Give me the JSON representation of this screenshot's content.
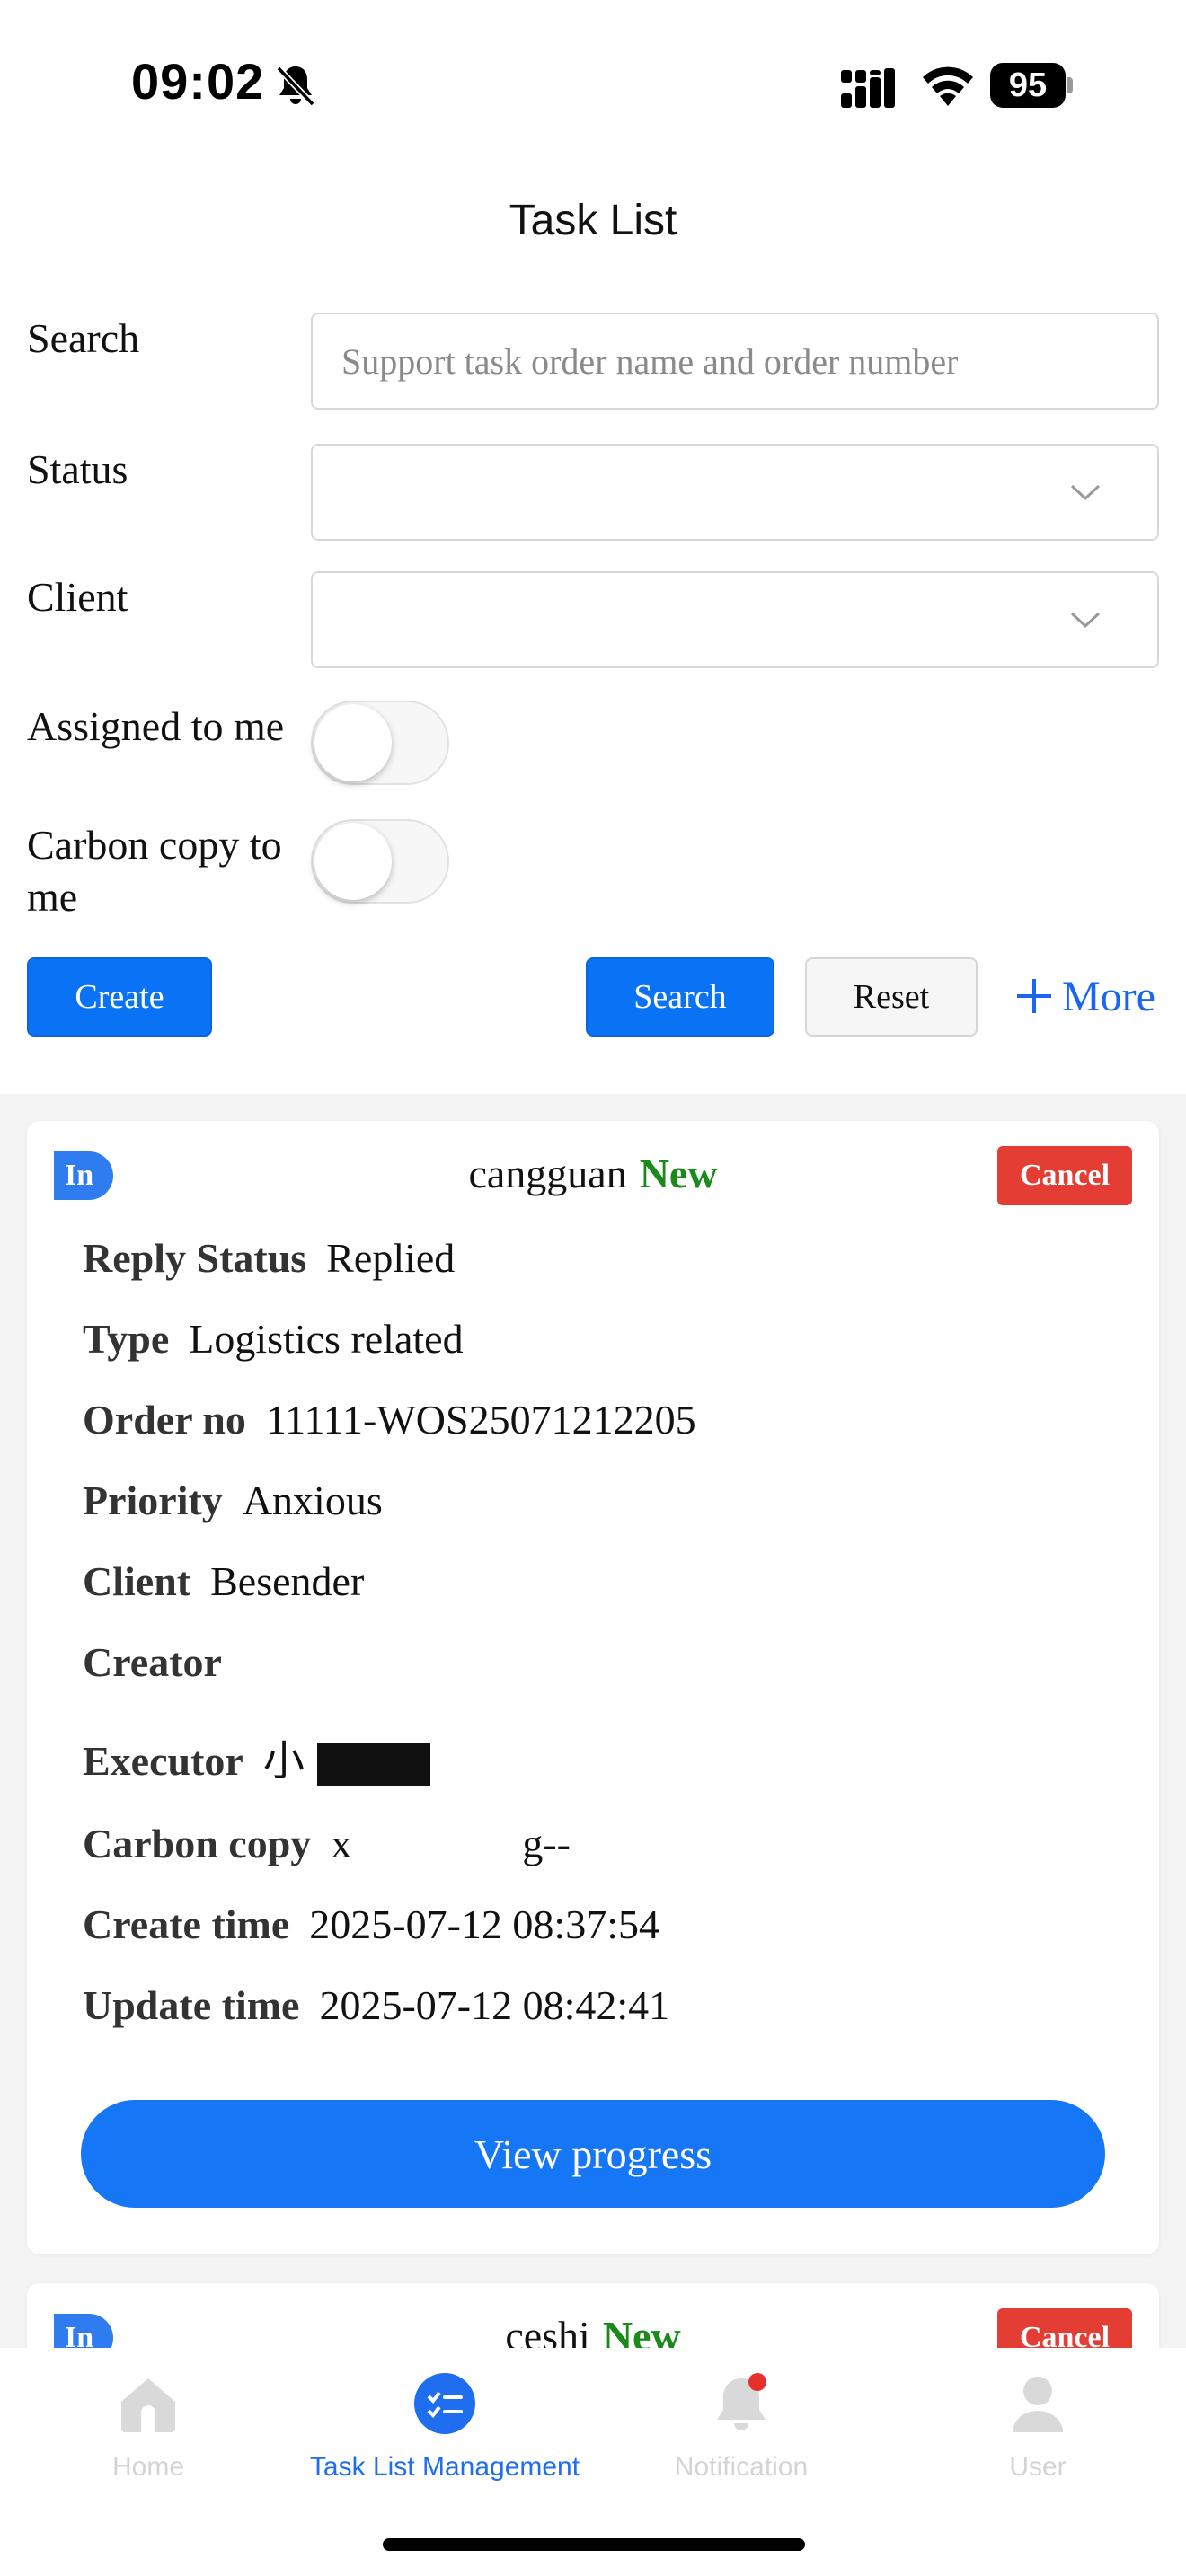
{
  "status_bar": {
    "time": "09:02",
    "battery": "95"
  },
  "page": {
    "title": "Task List"
  },
  "filters": {
    "search_label": "Search",
    "search_placeholder": "Support task order name and order number",
    "search_value": "",
    "status_label": "Status",
    "status_value": "",
    "client_label": "Client",
    "client_value": "",
    "assigned_label": "Assigned to me",
    "assigned_on": false,
    "cc_label": "Carbon copy to me",
    "cc_on": false
  },
  "actions": {
    "create": "Create",
    "search": "Search",
    "reset": "Reset",
    "more": "More"
  },
  "tasks": [
    {
      "badge": "In",
      "name": "cangguan",
      "state": "New",
      "cancel": "Cancel",
      "fields": [
        {
          "label": "Reply Status",
          "value": "Replied"
        },
        {
          "label": "Type",
          "value": "Logistics related"
        },
        {
          "label": "Order no",
          "value": "11111-WOS25071212205"
        },
        {
          "label": "Priority",
          "value": "Anxious"
        },
        {
          "label": "Client",
          "value": "Besender"
        },
        {
          "label": "Creator",
          "value": ""
        },
        {
          "label": "Executor",
          "value": "小"
        },
        {
          "label": "Carbon copy",
          "value": "x",
          "value_suffix": "g--"
        },
        {
          "label": "Create time",
          "value": "2025-07-12 08:37:54"
        },
        {
          "label": "Update time",
          "value": "2025-07-12 08:42:41"
        }
      ],
      "view_progress": "View progress"
    },
    {
      "badge": "In",
      "name": "ceshi",
      "state": "New",
      "cancel": "Cancel"
    }
  ],
  "tabbar": {
    "items": [
      {
        "label": "Home",
        "icon": "home-icon",
        "active": false
      },
      {
        "label": "Task List Management",
        "icon": "task-list-icon",
        "active": true
      },
      {
        "label": "Notification",
        "icon": "bell-icon",
        "active": false
      },
      {
        "label": "User",
        "icon": "user-icon",
        "active": false
      }
    ]
  },
  "colors": {
    "primary": "#0a73f5",
    "cancel": "#e43d33",
    "new_state": "#1a8a1a",
    "active_tab": "#1f6ef0"
  }
}
